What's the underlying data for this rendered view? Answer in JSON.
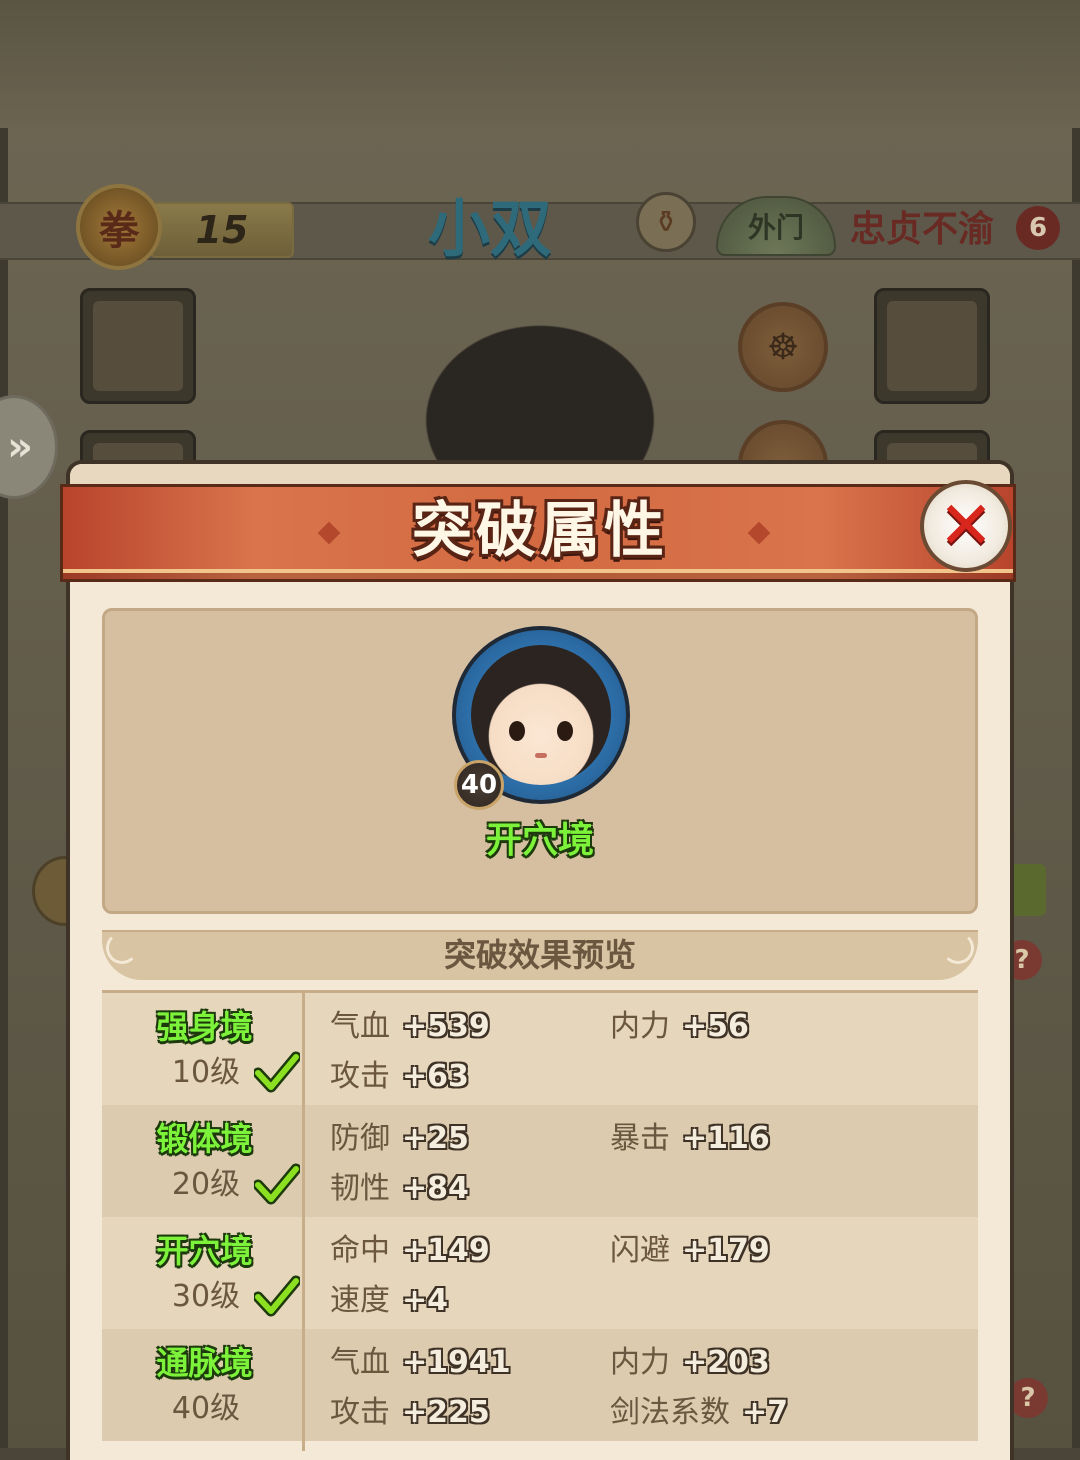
{
  "hero": {
    "class_badge": "拳",
    "level_text": "15",
    "name": "小双",
    "sect_tag": "外门",
    "loyalty_label": "忠贞不渝",
    "loyalty_value": "6"
  },
  "modal": {
    "title": "突破属性",
    "portrait_level": "40",
    "current_realm": "开穴境",
    "preview_title": "突破效果预览"
  },
  "breakthroughs": [
    {
      "realm": "强身境",
      "level": "10级",
      "achieved": true,
      "stats": [
        {
          "name": "气血",
          "value": "+539"
        },
        {
          "name": "内力",
          "value": "+56"
        },
        {
          "name": "攻击",
          "value": "+63"
        }
      ]
    },
    {
      "realm": "锻体境",
      "level": "20级",
      "achieved": true,
      "stats": [
        {
          "name": "防御",
          "value": "+25"
        },
        {
          "name": "暴击",
          "value": "+116"
        },
        {
          "name": "韧性",
          "value": "+84"
        }
      ]
    },
    {
      "realm": "开穴境",
      "level": "30级",
      "achieved": true,
      "stats": [
        {
          "name": "命中",
          "value": "+149"
        },
        {
          "name": "闪避",
          "value": "+179"
        },
        {
          "name": "速度",
          "value": "+4"
        }
      ]
    },
    {
      "realm": "通脉境",
      "level": "40级",
      "achieved": false,
      "stats": [
        {
          "name": "气血",
          "value": "+1941"
        },
        {
          "name": "内力",
          "value": "+203"
        },
        {
          "name": "攻击",
          "value": "+225"
        },
        {
          "name": "剑法系数",
          "value": "+7"
        }
      ]
    }
  ],
  "colors": {
    "banner_red": "#d36a42",
    "realm_green": "#7df23a",
    "check_green": "#8be022",
    "close_red": "#d8261c"
  }
}
